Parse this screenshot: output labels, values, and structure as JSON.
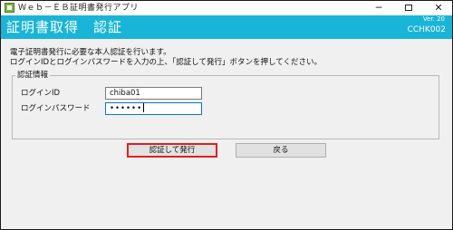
{
  "window": {
    "title": "Ｗｅｂ－ＥＢ証明書発行アプリ",
    "minimize_label": "─",
    "close_label": "✕"
  },
  "header": {
    "title": "証明書取得　認証",
    "version": "Ver. 20",
    "screen_id": "CCHK002",
    "background_color": "#19b5d8"
  },
  "instructions": {
    "line1": "電子証明書発行に必要な本人認証を行います。",
    "line2": "ログインIDとログインパスワードを入力の上、「認証して発行」ボタンを押してください。"
  },
  "auth_group": {
    "legend": "認証情報",
    "login_id_label": "ログインID",
    "login_id_value": "chiba01",
    "password_label": "ログインパスワード",
    "password_masked": "••••••"
  },
  "buttons": {
    "login": "認証して発行",
    "back": "戻る",
    "highlight_color": "#e02020"
  }
}
